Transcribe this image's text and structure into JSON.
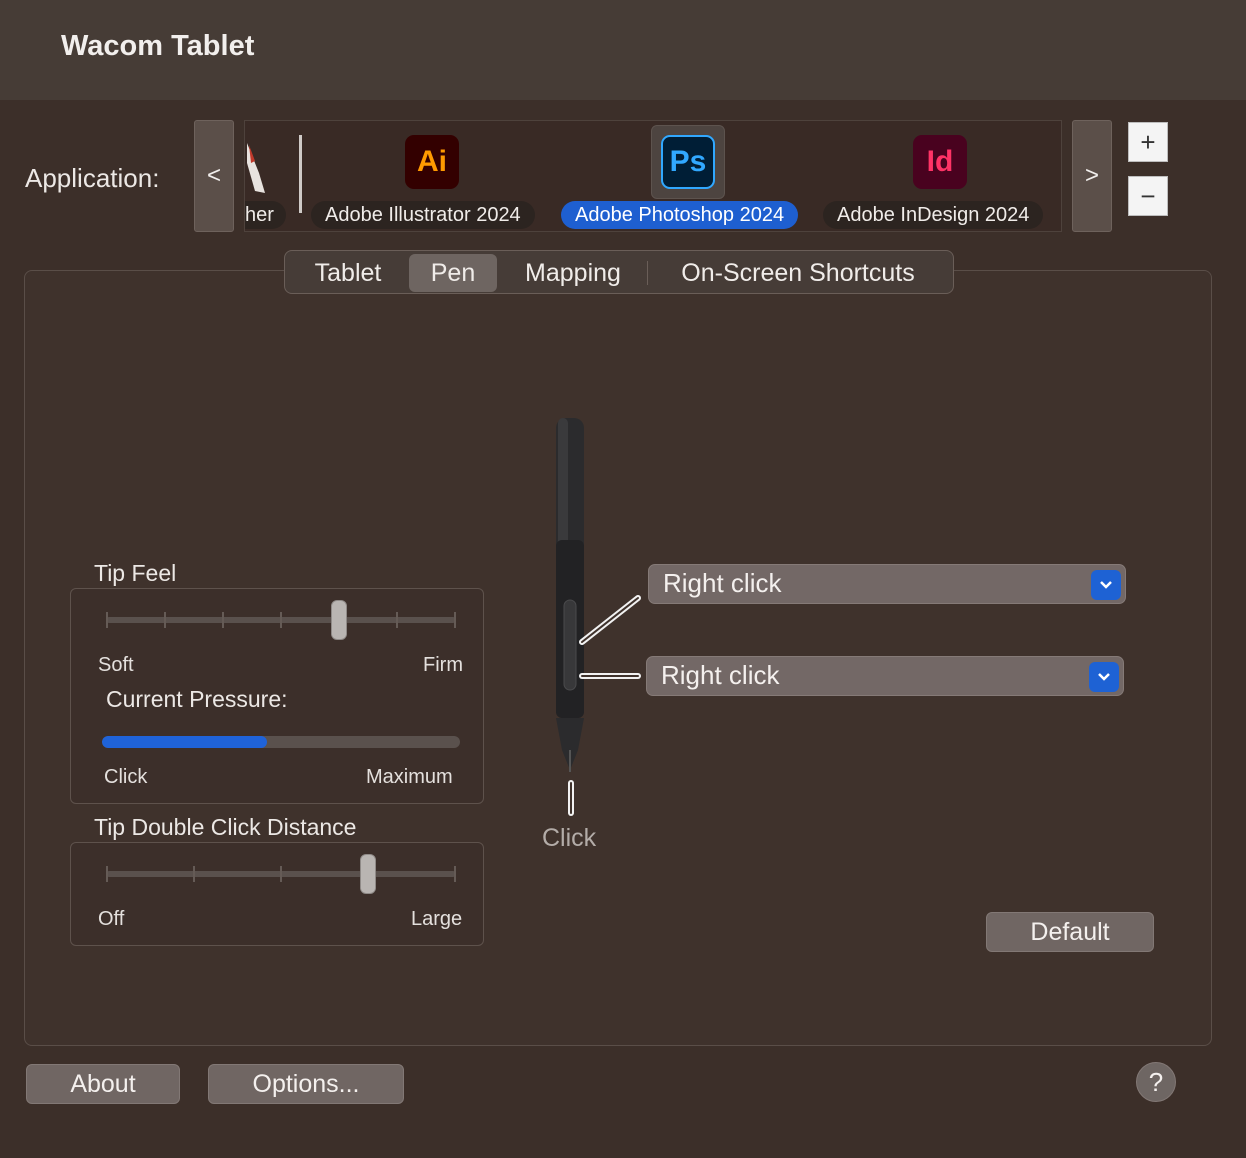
{
  "window": {
    "title": "Wacom Tablet"
  },
  "application": {
    "label": "Application:",
    "prev_label": "<",
    "next_label": ">",
    "add_label": "+",
    "remove_label": "−",
    "items": [
      {
        "name": "her",
        "icon": "pen-cursor-icon"
      },
      {
        "name": "Adobe Illustrator 2024",
        "icon_text": "Ai",
        "icon_bg": "#330000",
        "icon_fg": "#ff9a00"
      },
      {
        "name": "Adobe Photoshop 2024",
        "icon_text": "Ps",
        "icon_bg": "#001e36",
        "icon_fg": "#31a8ff",
        "selected": true
      },
      {
        "name": "Adobe InDesign 2024",
        "icon_text": "Id",
        "icon_bg": "#49021f",
        "icon_fg": "#ff3366"
      }
    ]
  },
  "tabs": [
    {
      "label": "Tablet"
    },
    {
      "label": "Pen",
      "active": true
    },
    {
      "label": "Mapping"
    },
    {
      "label": "On-Screen Shortcuts"
    }
  ],
  "tip_feel": {
    "title": "Tip Feel",
    "min_label": "Soft",
    "max_label": "Firm",
    "level_step": 4,
    "steps": 7,
    "current_pressure_label": "Current Pressure:",
    "pressure_fraction": 0.46,
    "pressure_min_label": "Click",
    "pressure_max_label": "Maximum"
  },
  "double_click": {
    "title": "Tip Double Click Distance",
    "min_label": "Off",
    "max_label": "Large",
    "level_step": 3,
    "steps": 5
  },
  "pen": {
    "upper_button": "Right click",
    "lower_button": "Right click",
    "tip_label": "Click"
  },
  "buttons": {
    "default": "Default",
    "about": "About",
    "options": "Options...",
    "help": "?"
  },
  "colors": {
    "accent": "#1e62d4",
    "background": "#3c2f29"
  }
}
